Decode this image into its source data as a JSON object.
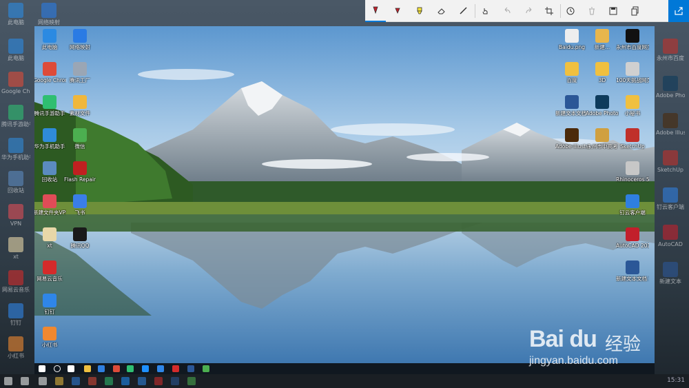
{
  "toolbar": {
    "buttons": [
      {
        "name": "ballpoint-pen-icon",
        "label": ""
      },
      {
        "name": "pencil-icon",
        "label": ""
      },
      {
        "name": "highlighter-icon",
        "label": ""
      },
      {
        "name": "eraser-icon",
        "label": ""
      },
      {
        "name": "ruler-icon",
        "label": ""
      },
      {
        "name": "touch-writing-icon",
        "label": ""
      },
      {
        "name": "undo-icon",
        "label": ""
      },
      {
        "name": "redo-icon",
        "label": ""
      },
      {
        "name": "crop-icon",
        "label": ""
      },
      {
        "name": "history-icon",
        "label": ""
      },
      {
        "name": "delete-icon",
        "label": ""
      },
      {
        "name": "save-icon",
        "label": ""
      },
      {
        "name": "copy-icon",
        "label": ""
      },
      {
        "name": "share-icon",
        "label": ""
      }
    ]
  },
  "desktop_left": [
    {
      "label": "此电脑",
      "color": "#2b8ae2"
    },
    {
      "label": "Google Chrome",
      "color": "#dd4b39"
    },
    {
      "label": "腾讯手游助手",
      "color": "#2fbf71"
    },
    {
      "label": "华为手机助手",
      "color": "#2f8bd9"
    },
    {
      "label": "回收站",
      "color": "#5b8bbf"
    },
    {
      "label": "新建文件夹VPN",
      "color": "#e04c57"
    },
    {
      "label": "xt",
      "color": "#e8d7a8"
    },
    {
      "label": "网易云音乐",
      "color": "#d42b2b"
    },
    {
      "label": "钉钉",
      "color": "#2f86e8"
    },
    {
      "label": "小红书",
      "color": "#f08830"
    }
  ],
  "desktop_left2": [
    {
      "label": "网络映射",
      "color": "#2a7be4"
    },
    {
      "label": "腾讯工厂",
      "color": "#9aa6b5"
    },
    {
      "label": "素材文件",
      "color": "#f0b73c"
    },
    {
      "label": "微信",
      "color": "#4caf50"
    },
    {
      "label": "Flash Repair",
      "color": "#c02020"
    },
    {
      "label": "飞书",
      "color": "#3a7ee8"
    },
    {
      "label": "腾讯QQ",
      "color": "#1a1a1a"
    }
  ],
  "desktop_right": [
    {
      "label": "Baidu.png",
      "color": "#eeeeee"
    },
    {
      "label": "新建...",
      "color": "#e8b64c"
    },
    {
      "label": "永州市百度网页截图.png",
      "color": "#111111"
    },
    {
      "label": "百度",
      "color": "#f0c040"
    },
    {
      "label": "3D",
      "color": "#f0c040"
    },
    {
      "label": "100天挑战网页V1.0",
      "color": "#d0d0d0"
    },
    {
      "label": "新建文本文档 02807.docx",
      "color": "#2b5797"
    },
    {
      "label": "Adobe Photosh...",
      "color": "#0e3b5c"
    },
    {
      "label": "小秘书",
      "color": "#f0c040"
    },
    {
      "label": "Adobe Illustrat...",
      "color": "#4b2a0a"
    },
    {
      "label": "永州市中高考",
      "color": "#d0a040"
    },
    {
      "label": "SketchUp",
      "color": "#c0302a"
    },
    {
      "label": "Rhinoceros 5 (64-bit)",
      "color": "#c7c7c7"
    },
    {
      "label": "钉云客户端",
      "color": "#2f7fe0"
    },
    {
      "label": "AutoCAD 2016 - 简体",
      "color": "#c21f2b"
    },
    {
      "label": "新建文本文档 1 未命名文件",
      "color": "#2b5797"
    }
  ],
  "outer_left": [
    {
      "label": "此电脑",
      "color": "#2b8ae2"
    },
    {
      "label": "Google Chrome",
      "color": "#dd4b39"
    },
    {
      "label": "腾讯手游助手",
      "color": "#2fbf71"
    },
    {
      "label": "华为手机助手",
      "color": "#2f8bd9"
    },
    {
      "label": "回收站",
      "color": "#5b8bbf"
    },
    {
      "label": "VPN",
      "color": "#e04c57"
    },
    {
      "label": "xt",
      "color": "#e8d7a8"
    },
    {
      "label": "网易云音乐",
      "color": "#d42b2b"
    },
    {
      "label": "钉钉",
      "color": "#2f86e8"
    },
    {
      "label": "小红书",
      "color": "#f08830"
    }
  ],
  "outer_right": [
    {
      "label": "永州市百度",
      "color": "#c0302a"
    },
    {
      "label": "Adobe Photoshop",
      "color": "#0e3b5c"
    },
    {
      "label": "Adobe Illustrator",
      "color": "#4b2a0a"
    },
    {
      "label": "SketchUp",
      "color": "#c0302a"
    },
    {
      "label": "钉云客户端",
      "color": "#2f7fe0"
    },
    {
      "label": "AutoCAD",
      "color": "#c21f2b"
    },
    {
      "label": "新建文本",
      "color": "#2b5797"
    }
  ],
  "outer_top_left": [
    {
      "label": "此电脑",
      "color": "#2b8ae2"
    },
    {
      "label": "网络映射",
      "color": "#2a7be4"
    }
  ],
  "outer_clock": "15:31",
  "watermark": {
    "brand": "Bai du",
    "cn": "经验",
    "url": "jingyan.baidu.com"
  }
}
